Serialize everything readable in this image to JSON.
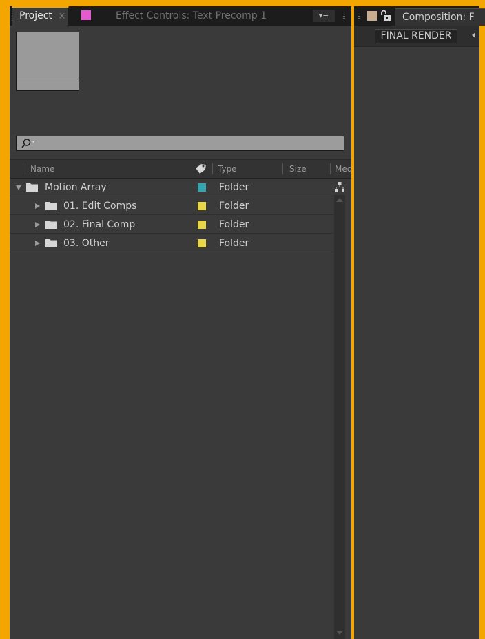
{
  "project_panel": {
    "tab_label": "Project",
    "tab_close": "×",
    "effect_tab_label": "Effect Controls: Text Precomp 1",
    "effect_tab_swatch": "#e55ad0",
    "menu_icon": "▾≡",
    "search": {
      "value": "",
      "placeholder": ""
    },
    "columns": [
      {
        "label": "Name"
      },
      {
        "label": "Type"
      },
      {
        "label": "Size"
      },
      {
        "label": "Med"
      }
    ],
    "items": [
      {
        "name": "Motion Array",
        "type": "Folder",
        "label_color": "#3aa3b0",
        "expanded": true,
        "level": 0
      },
      {
        "name": "01. Edit Comps",
        "type": "Folder",
        "label_color": "#e8d64a",
        "expanded": false,
        "level": 1
      },
      {
        "name": "02. Final Comp",
        "type": "Folder",
        "label_color": "#e8d64a",
        "expanded": false,
        "level": 1
      },
      {
        "name": "03. Other",
        "type": "Folder",
        "label_color": "#e8d64a",
        "expanded": false,
        "level": 1
      }
    ]
  },
  "composition_panel": {
    "tab_label": "Composition: F",
    "swatch_color": "#c8ad8e",
    "toolbar_button": "FINAL RENDER"
  },
  "colors": {
    "workspace_border": "#f4a600",
    "panel_bg": "#3a3a3a"
  }
}
